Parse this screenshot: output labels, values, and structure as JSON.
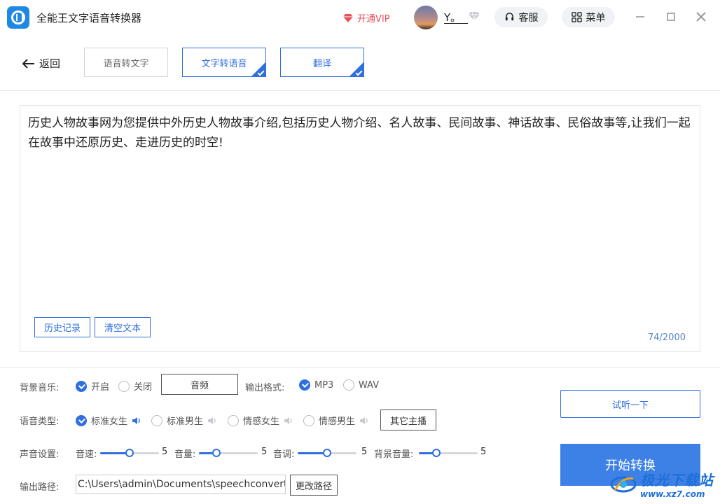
{
  "titlebar": {
    "app_title": "全能王文字语音转换器",
    "vip_label": "开通VIP",
    "username": "Y。",
    "service_label": "客服",
    "menu_label": "菜单"
  },
  "nav": {
    "back_label": "返回",
    "tabs": [
      {
        "label": "语音转文字",
        "selected": false
      },
      {
        "label": "文字转语音",
        "selected": true
      },
      {
        "label": "翻译",
        "selected": true
      }
    ]
  },
  "editor": {
    "text": "历史人物故事网为您提供中外历史人物故事介绍,包括历史人物介绍、名人故事、民间故事、神话故事、民俗故事等,让我们一起在故事中还原历史、走进历史的时空!",
    "history_label": "历史记录",
    "clear_label": "清空文本",
    "counter": "74/2000"
  },
  "settings": {
    "bg_music": {
      "label": "背景音乐:",
      "options": [
        {
          "label": "开启",
          "checked": true
        },
        {
          "label": "关闭",
          "checked": false
        }
      ],
      "audio_button": "音频"
    },
    "output_format": {
      "label": "输出格式:",
      "options": [
        {
          "label": "MP3",
          "checked": true
        },
        {
          "label": "WAV",
          "checked": false
        }
      ]
    },
    "voice_type": {
      "label": "语音类型:",
      "options": [
        {
          "label": "标准女生",
          "checked": true
        },
        {
          "label": "标准男生",
          "checked": false
        },
        {
          "label": "情感女生",
          "checked": false
        },
        {
          "label": "情感男生",
          "checked": false
        }
      ],
      "other_button": "其它主播"
    },
    "sound": {
      "label": "声音设置:",
      "sliders": [
        {
          "label": "音速:",
          "value": "5",
          "level": 0.5
        },
        {
          "label": "音量:",
          "value": "5",
          "level": 0.3
        },
        {
          "label": "音调:",
          "value": "5",
          "level": 0.5
        },
        {
          "label": "背景音量:",
          "value": "5",
          "level": 0.3
        }
      ]
    },
    "output_path": {
      "label": "输出路径:",
      "value": "C:\\Users\\admin\\Documents\\speechconvert_",
      "change_button": "更改路径"
    }
  },
  "actions": {
    "listen_label": "试听一下",
    "start_label": "开始转换"
  },
  "watermark": {
    "name": "极光下载站",
    "url": "www.xz7.com"
  },
  "colors": {
    "accent": "#2f6fde",
    "start_button": "#3d80e6",
    "vip": "#e8505b"
  }
}
